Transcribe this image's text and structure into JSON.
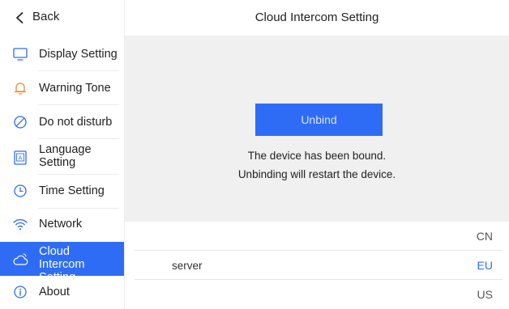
{
  "sidebar": {
    "back_label": "Back",
    "items": [
      {
        "label": "Display Setting",
        "icon": "monitor-icon"
      },
      {
        "label": "Warning Tone",
        "icon": "bell-icon"
      },
      {
        "label": "Do not disturb",
        "icon": "do-not-disturb-icon"
      },
      {
        "label": "Language Setting",
        "icon": "language-icon"
      },
      {
        "label": "Time Setting",
        "icon": "clock-icon"
      },
      {
        "label": "Network",
        "icon": "wifi-icon"
      },
      {
        "label": "Cloud Intercom Setting",
        "icon": "cloud-icon",
        "active": true
      },
      {
        "label": "About",
        "icon": "info-icon"
      }
    ]
  },
  "header": {
    "title": "Cloud Intercom Setting"
  },
  "main": {
    "unbind_label": "Unbind",
    "message_line1": "The device has been bound.",
    "message_line2": "Unbinding will restart the device."
  },
  "server": {
    "label": "server",
    "options": [
      "CN",
      "EU",
      "US"
    ],
    "selected": "EU"
  },
  "colors": {
    "accent": "#2f6cf6",
    "bell_orange": "#f08c2a",
    "icon_blue": "#2f6cf6",
    "panel_gray": "#f0f0f0"
  }
}
